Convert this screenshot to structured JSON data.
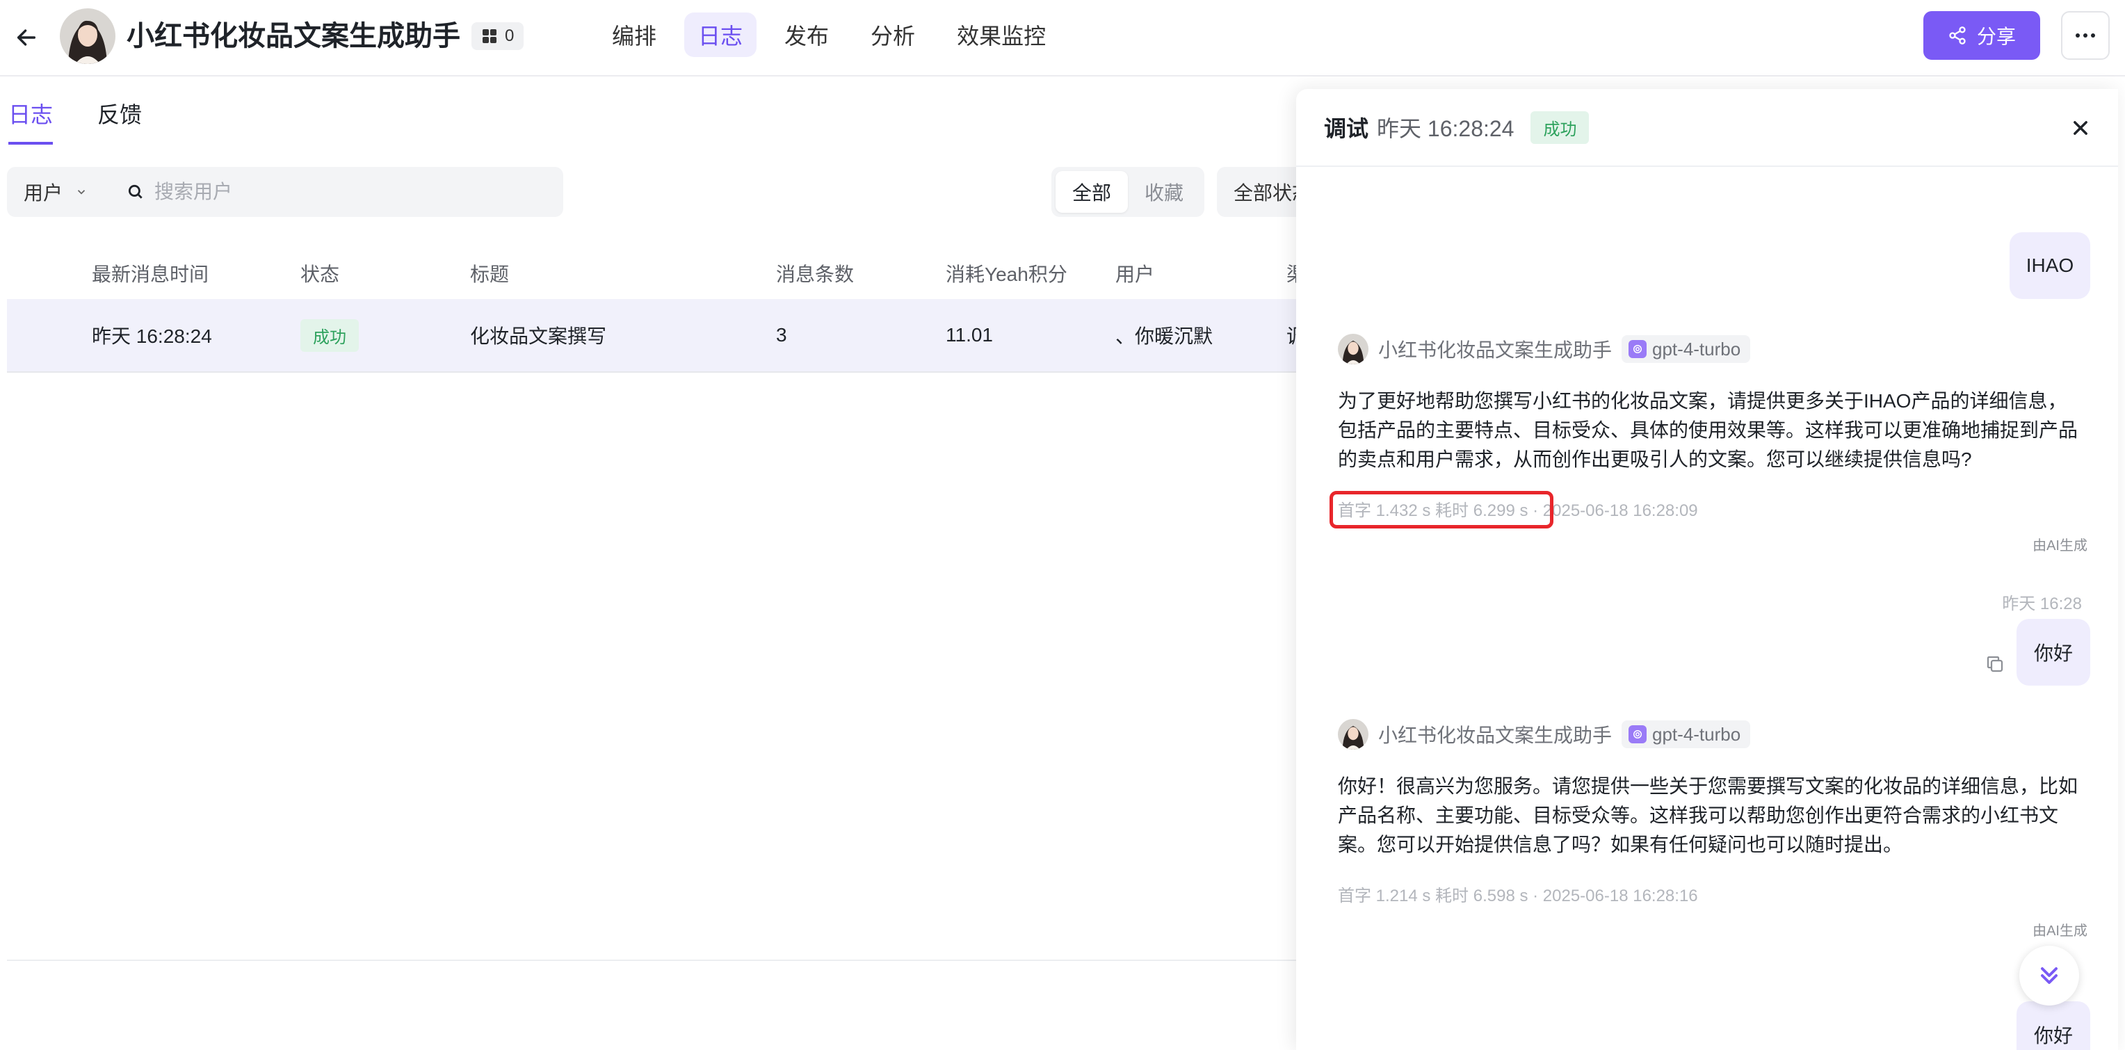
{
  "app": {
    "title": "小红书化妆品文案生成助手",
    "count": "0"
  },
  "nav": {
    "items": [
      "编排",
      "日志",
      "发布",
      "分析",
      "效果监控"
    ],
    "active": "日志"
  },
  "header": {
    "share_label": "分享",
    "more_label": "···"
  },
  "subtabs": {
    "items": [
      "日志",
      "反馈"
    ],
    "active": "日志"
  },
  "filters": {
    "user_select": "用户",
    "search_placeholder": "搜索用户",
    "segment": [
      "全部",
      "收藏"
    ],
    "segment_active": "全部",
    "status": "全部状态"
  },
  "table": {
    "columns": [
      "最新消息时间",
      "状态",
      "标题",
      "消息条数",
      "消耗Yeah积分",
      "用户",
      "渠道"
    ],
    "rows": [
      {
        "time": "昨天 16:28:24",
        "status": "成功",
        "title": "化妆品文案撰写",
        "messages": "3",
        "credits": "11.01",
        "user": "、你暖沉默",
        "channel": "调试"
      }
    ]
  },
  "panel": {
    "title": "调试",
    "time": "昨天 16:28:24",
    "status": "成功",
    "messages": [
      {
        "role": "user",
        "text": "IHAO"
      },
      {
        "role": "bot",
        "name": "小红书化妆品文案生成助手",
        "model": "gpt-4-turbo",
        "lines": [
          "为了更好地帮助您撰写小红书的化妆品文案，请提供更多关于IHAO产品的详细信息，",
          "包括产品的主要特点、目标受众、具体的使用效果等。这样我可以更准确地捕捉到产品",
          "的卖点和用户需求，从而创作出更吸引人的文案。您可以继续提供信息吗?"
        ],
        "meta": "首字 1.432 s 耗时 6.299 s · 2025-06-18 16:28:09",
        "ai_label": "由AI生成"
      },
      {
        "role": "user",
        "timestamp": "昨天 16:28",
        "text": "你好"
      },
      {
        "role": "bot",
        "name": "小红书化妆品文案生成助手",
        "model": "gpt-4-turbo",
        "lines": [
          "你好！很高兴为您服务。请您提供一些关于您需要撰写文案的化妆品的详细信息，比如",
          "产品名称、主要功能、目标受众等。这样我可以帮助您创作出更符合需求的小红书文",
          "案。您可以开始提供信息了吗？如果有任何疑问也可以随时提出。"
        ],
        "meta": "首字 1.214 s 耗时 6.598 s · 2025-06-18 16:28:16",
        "ai_label": "由AI生成"
      },
      {
        "role": "user",
        "text": "你好"
      }
    ]
  },
  "colors": {
    "accent": "#7a5af5",
    "accent_soft": "#efedfd",
    "success": "#2ea25d",
    "success_bg": "#e3f4ea",
    "highlight": "#e8262b"
  }
}
